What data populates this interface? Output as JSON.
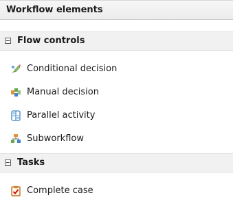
{
  "panel": {
    "title": "Workflow elements"
  },
  "groups": [
    {
      "label": "Flow controls",
      "items": [
        {
          "label": "Conditional decision",
          "icon": "conditional-decision-icon"
        },
        {
          "label": "Manual decision",
          "icon": "manual-decision-icon"
        },
        {
          "label": "Parallel activity",
          "icon": "parallel-activity-icon"
        },
        {
          "label": "Subworkflow",
          "icon": "subworkflow-icon"
        }
      ]
    },
    {
      "label": "Tasks",
      "items": [
        {
          "label": "Complete case",
          "icon": "complete-case-icon"
        }
      ]
    }
  ],
  "colors": {
    "header_bg": "#ececec",
    "group_bg": "#f1f1f1",
    "text": "#1a1a1a"
  }
}
